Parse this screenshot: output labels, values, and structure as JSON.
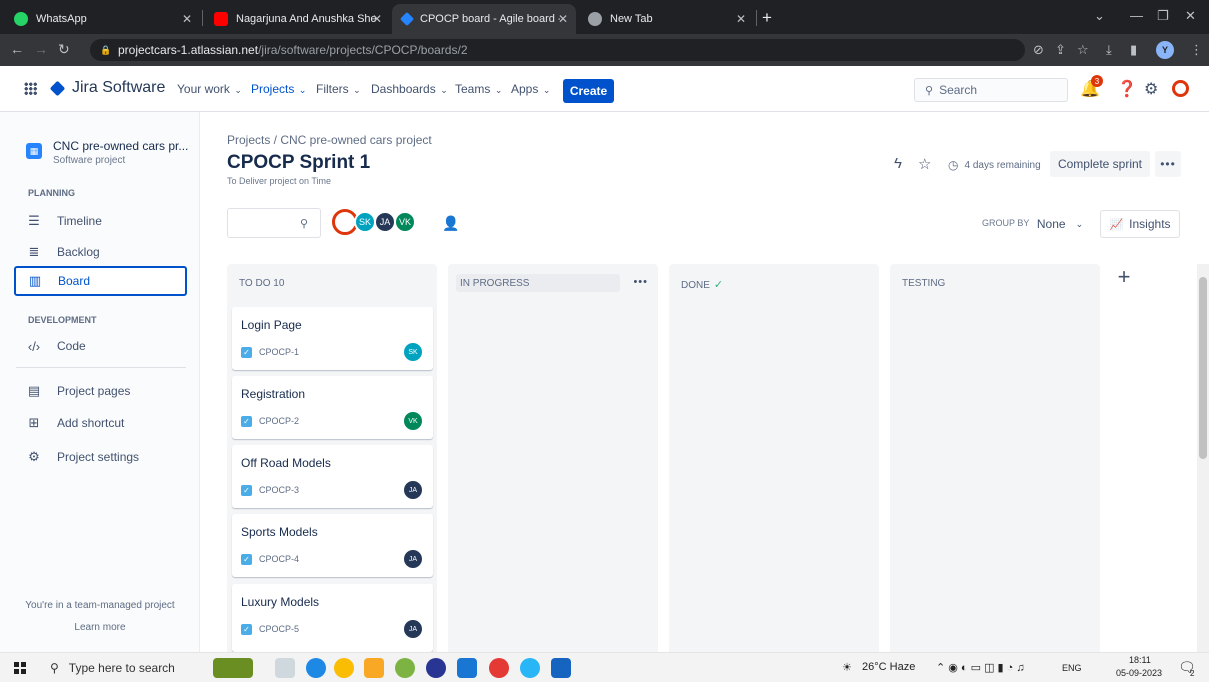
{
  "browser": {
    "tabs": [
      {
        "title": "WhatsApp",
        "color": "#25d366"
      },
      {
        "title": "Nagarjuna And Anushka Shetty R",
        "color": "#ff0000"
      },
      {
        "title": "CPOCP board - Agile board - Jira",
        "color": "#2684ff"
      },
      {
        "title": "New Tab",
        "color": "#9aa0a6"
      }
    ],
    "url_host": "projectcars-1.atlassian.net",
    "url_path": "/jira/software/projects/CPOCP/boards/2",
    "profile_initial": "Y"
  },
  "jira_nav": {
    "product": "Jira Software",
    "items": [
      "Your work",
      "Projects",
      "Filters",
      "Dashboards",
      "Teams",
      "Apps"
    ],
    "create_label": "Create",
    "search_placeholder": "Search",
    "notification_count": "3"
  },
  "sidebar": {
    "project_name": "CNC pre-owned cars pr...",
    "project_type": "Software project",
    "planning_heading": "PLANNING",
    "planning_items": [
      "Timeline",
      "Backlog",
      "Board"
    ],
    "development_heading": "DEVELOPMENT",
    "development_items": [
      "Code"
    ],
    "other_items": [
      "Project pages",
      "Add shortcut",
      "Project settings"
    ],
    "team_note": "You're in a team-managed project",
    "learn_more": "Learn more"
  },
  "main": {
    "breadcrumb": "Projects  /  CNC pre-owned cars project",
    "sprint_title": "CPOCP Sprint 1",
    "sprint_goal": "To Deliver project on Time",
    "remaining": "4 days remaining",
    "complete_label": "Complete sprint",
    "avatars": [
      {
        "initials": "",
        "color": "#de350b"
      },
      {
        "initials": "SK",
        "color": "#00a3bf"
      },
      {
        "initials": "JA",
        "color": "#253858"
      },
      {
        "initials": "VK",
        "color": "#00875a"
      }
    ],
    "group_by_label": "GROUP BY",
    "group_by_value": "None",
    "insights_label": "Insights",
    "columns": [
      "TO DO 10",
      "IN PROGRESS",
      "DONE",
      "TESTING"
    ],
    "cards": [
      {
        "title": "Login Page",
        "key": "CPOCP-1",
        "assignee": "SK",
        "color": "#00a3bf"
      },
      {
        "title": "Registration",
        "key": "CPOCP-2",
        "assignee": "VK",
        "color": "#00875a"
      },
      {
        "title": "Off Road Models",
        "key": "CPOCP-3",
        "assignee": "JA",
        "color": "#253858"
      },
      {
        "title": "Sports Models",
        "key": "CPOCP-4",
        "assignee": "JA",
        "color": "#253858"
      },
      {
        "title": "Luxury Models",
        "key": "CPOCP-5",
        "assignee": "JA",
        "color": "#253858"
      }
    ]
  },
  "taskbar": {
    "search_placeholder": "Type here to search",
    "weather": "26°C  Haze",
    "language": "ENG",
    "time": "18:11",
    "date": "05-09-2023",
    "notification_count": "2"
  }
}
